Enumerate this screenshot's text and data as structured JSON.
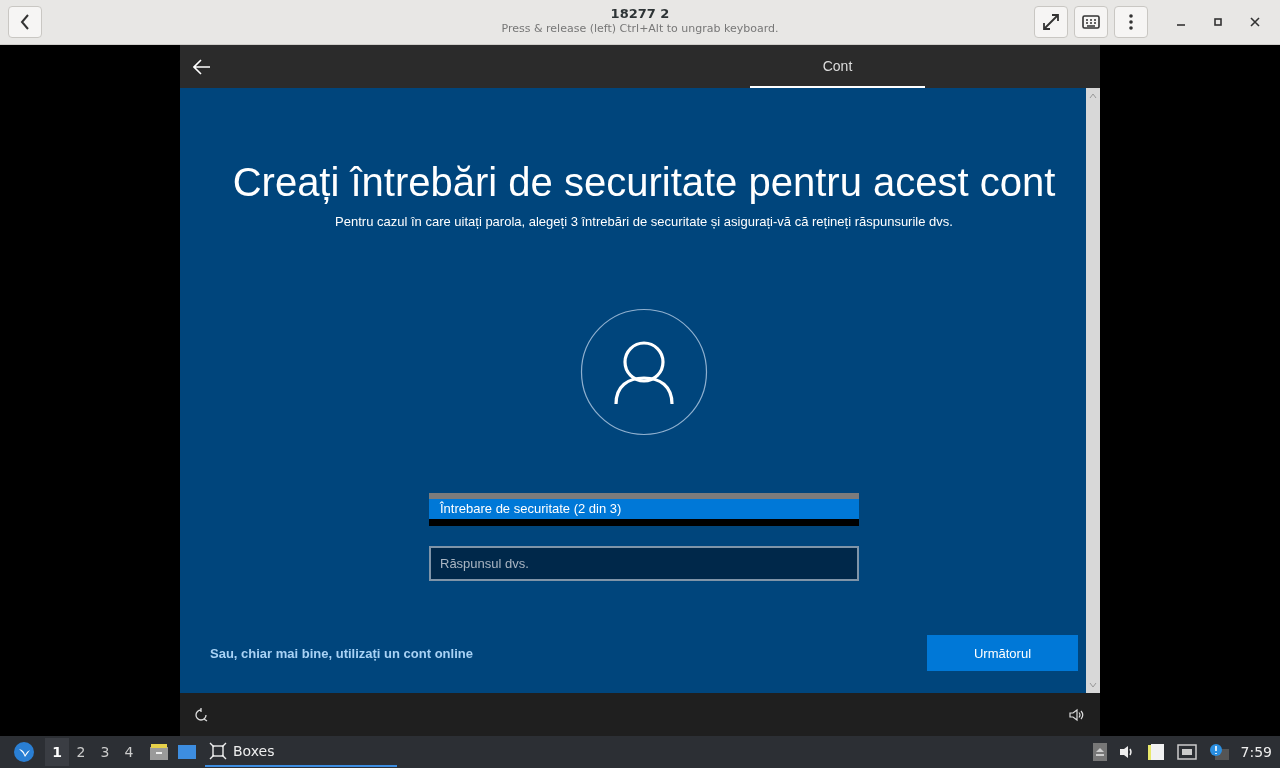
{
  "titlebar": {
    "title": "18277 2",
    "subtitle": "Press & release (left) Ctrl+Alt to ungrab keyboard."
  },
  "vm": {
    "tabs": [
      {
        "label": "Cont",
        "selected": true
      }
    ],
    "heading": "Creați întrebări de securitate pentru acest cont",
    "subtitle": "Pentru cazul în care uitați parola, alegeți 3 întrebări de securitate și asigurați-vă că rețineți răspunsurile dvs.",
    "dropdown": {
      "options": [
        {
          "label": "Întrebare de securitate (2 din 3)",
          "selected": true
        }
      ]
    },
    "answer": {
      "placeholder": "Răspunsul dvs."
    },
    "link": "Sau, chiar mai bine, utilizați un cont online",
    "next_button": "Următorul"
  },
  "taskbar": {
    "workspaces": [
      {
        "label": "1",
        "selected": true
      },
      {
        "label": "2",
        "selected": false
      },
      {
        "label": "3",
        "selected": false
      },
      {
        "label": "4",
        "selected": false
      }
    ],
    "tasks": [
      {
        "label": "Boxes",
        "selected": true
      }
    ],
    "clock": "7:59"
  }
}
